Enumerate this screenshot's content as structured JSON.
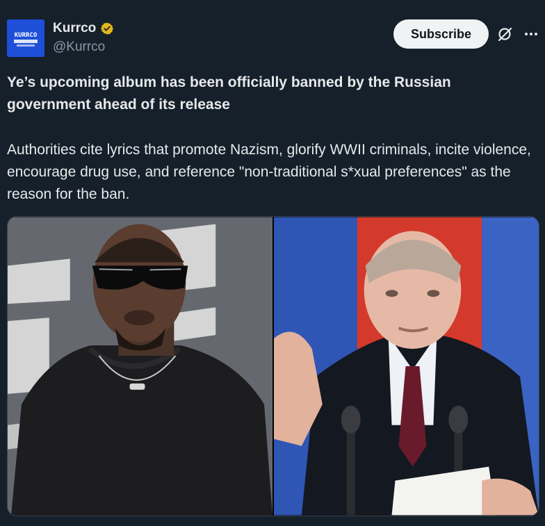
{
  "author": {
    "display_name": "Kurrco",
    "handle": "@Kurrco",
    "verified": true,
    "avatar_text": "KURRCO"
  },
  "actions": {
    "subscribe_label": "Subscribe",
    "grok_icon": "grok-icon",
    "more_icon": "more-icon"
  },
  "post": {
    "headline": "Ye’s upcoming album has been officially banned by the Russian government ahead of its release",
    "body": "Authorities cite lyrics that promote Nazism, glorify WWII criminals, incite violence, encourage drug use, and reference \"non-traditional s*xual preferences\" as the reason for the ban."
  },
  "media": {
    "photos": [
      "man-in-sunglasses-photo",
      "speaker-at-microphones-photo"
    ]
  },
  "colors": {
    "background": "#15202b",
    "text_primary": "#e7e9ea",
    "text_secondary": "#8b98a5",
    "verified_gold": "#e2b719",
    "subscribe_bg": "#eff3f4"
  }
}
